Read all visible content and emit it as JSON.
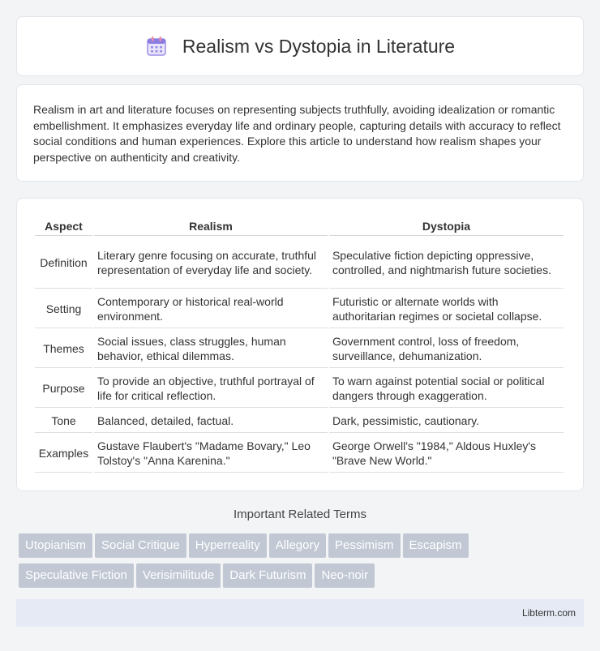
{
  "header": {
    "title": "Realism vs Dystopia in Literature",
    "icon": "calendar-icon"
  },
  "intro": "Realism in art and literature focuses on representing subjects truthfully, avoiding idealization or romantic embellishment. It emphasizes everyday life and ordinary people, capturing details with accuracy to reflect social conditions and human experiences. Explore this article to understand how realism shapes your perspective on authenticity and creativity.",
  "table": {
    "headers": [
      "Aspect",
      "Realism",
      "Dystopia"
    ],
    "rows": [
      {
        "aspect": "Definition",
        "realism": "Literary genre focusing on accurate, truthful representation of everyday life and society.",
        "dystopia": "Speculative fiction depicting oppressive, controlled, and nightmarish future societies."
      },
      {
        "aspect": "Setting",
        "realism": "Contemporary or historical real-world environment.",
        "dystopia": "Futuristic or alternate worlds with authoritarian regimes or societal collapse."
      },
      {
        "aspect": "Themes",
        "realism": "Social issues, class struggles, human behavior, ethical dilemmas.",
        "dystopia": "Government control, loss of freedom, surveillance, dehumanization."
      },
      {
        "aspect": "Purpose",
        "realism": "To provide an objective, truthful portrayal of life for critical reflection.",
        "dystopia": "To warn against potential social or political dangers through exaggeration."
      },
      {
        "aspect": "Tone",
        "realism": "Balanced, detailed, factual.",
        "dystopia": "Dark, pessimistic, cautionary."
      },
      {
        "aspect": "Examples",
        "realism": "Gustave Flaubert's \"Madame Bovary,\" Leo Tolstoy's \"Anna Karenina.\"",
        "dystopia": "George Orwell's \"1984,\" Aldous Huxley's \"Brave New World.\""
      }
    ]
  },
  "related": {
    "title": "Important Related Terms",
    "tags": [
      "Utopianism",
      "Social Critique",
      "Hyperreality",
      "Allegory",
      "Pessimism",
      "Escapism",
      "Speculative Fiction",
      "Verisimilitude",
      "Dark Futurism",
      "Neo-noir"
    ]
  },
  "footer": {
    "site": "Libterm.com"
  }
}
